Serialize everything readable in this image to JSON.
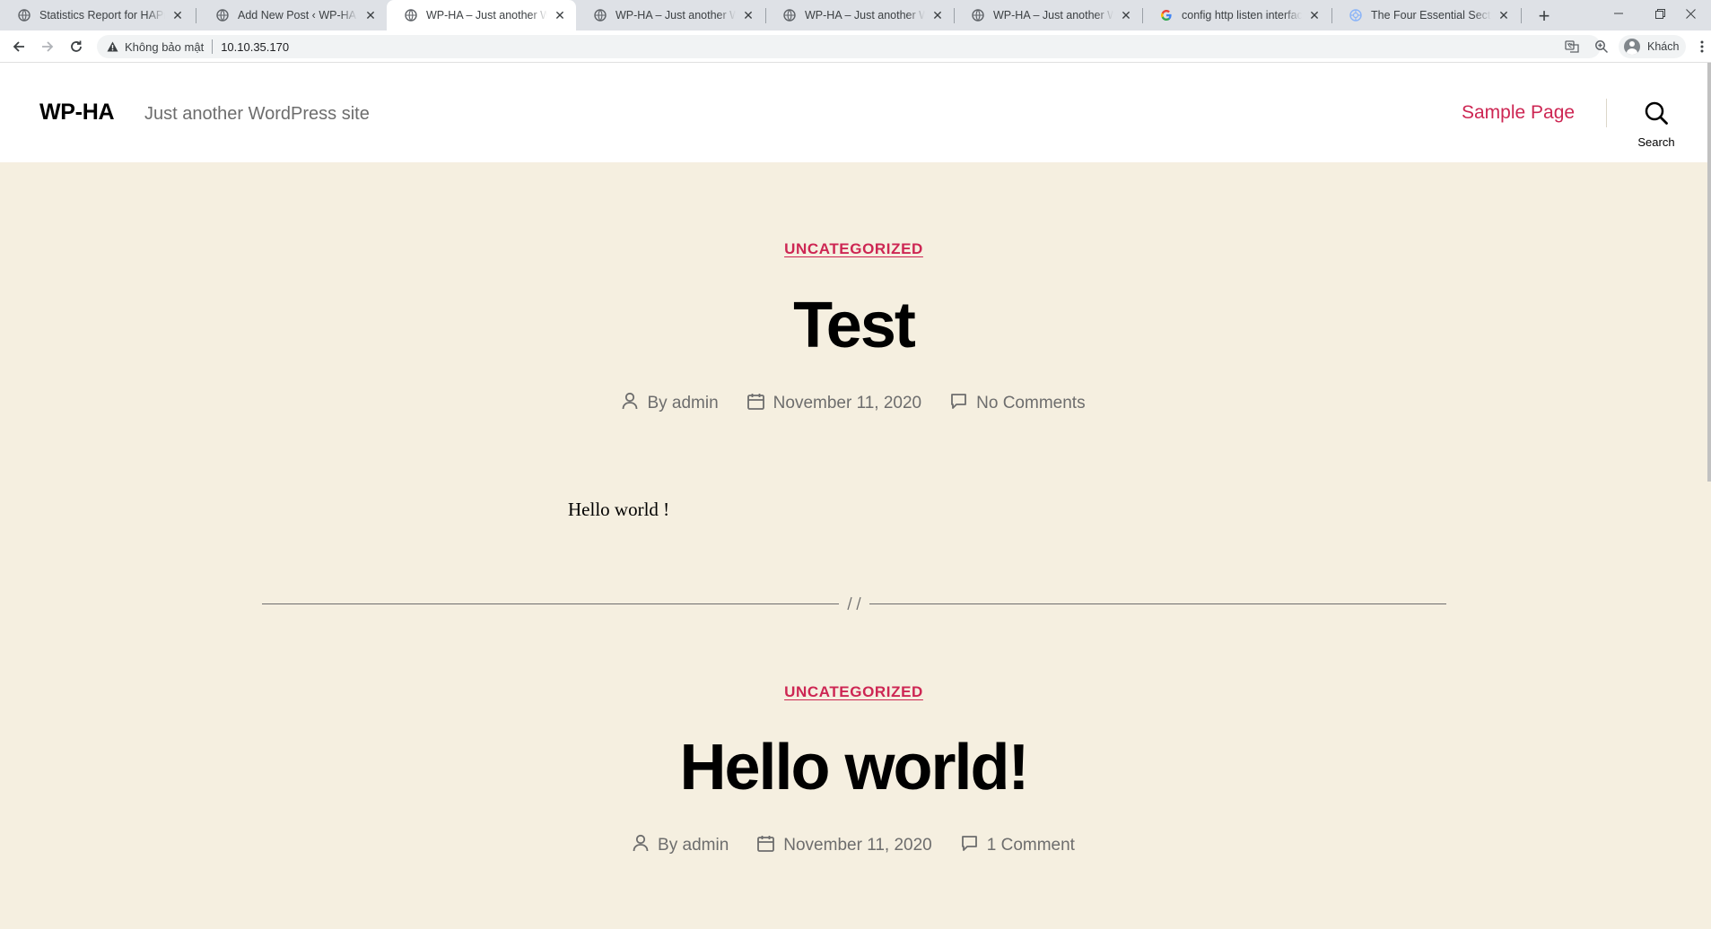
{
  "browser": {
    "tabs": [
      {
        "title": "Statistics Report for HAProxy",
        "active": false
      },
      {
        "title": "Add New Post ‹ WP-HA — WordPress",
        "active": false
      },
      {
        "title": "WP-HA – Just another WordPress site",
        "active": true
      },
      {
        "title": "WP-HA – Just another WordPress site",
        "active": false
      },
      {
        "title": "WP-HA – Just another WordPress site",
        "active": false
      },
      {
        "title": "WP-HA – Just another WordPress site",
        "active": false
      },
      {
        "title": "config http listen interface haproxy",
        "active": false
      },
      {
        "title": "The Four Essential Sections of an",
        "active": false
      }
    ],
    "new_tab_symbol": "+",
    "security_label": "Không bảo mật",
    "url": "10.10.35.170",
    "profile_name": "Khách"
  },
  "site": {
    "title": "WP-HA",
    "description": "Just another WordPress site",
    "nav": [
      "Sample Page"
    ],
    "search_label": "Search",
    "accent_color": "#cd2653",
    "background_color": "#f5efe0"
  },
  "posts": [
    {
      "category": "UNCATEGORIZED",
      "title": "Test",
      "author_prefix": "By",
      "author": "admin",
      "date": "November 11, 2020",
      "comments": "No Comments",
      "content": "Hello world !"
    },
    {
      "category": "UNCATEGORIZED",
      "title": "Hello world!",
      "author_prefix": "By",
      "author": "admin",
      "date": "November 11, 2020",
      "comments": "1 Comment"
    }
  ]
}
